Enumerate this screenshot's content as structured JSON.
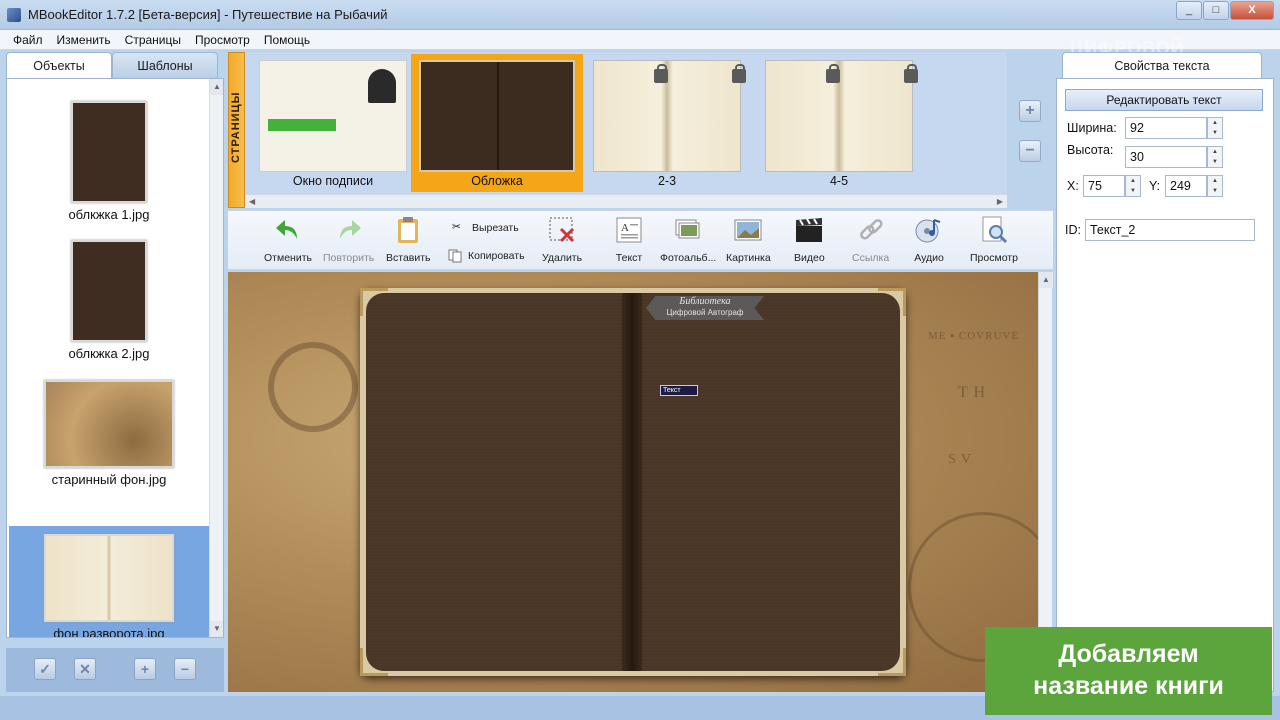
{
  "window": {
    "title": "MBookEditor 1.7.2 [Бета-версия] - Путешествие на Рыбачий",
    "buttons": [
      "_",
      "□",
      "X"
    ]
  },
  "menu": [
    "Файл",
    "Изменить",
    "Страницы",
    "Просмотр",
    "Помощь"
  ],
  "left_panel": {
    "tabs": [
      "Объекты",
      "Шаблоны"
    ],
    "items": [
      {
        "label": "облкжка 1.jpg"
      },
      {
        "label": "облкжка 2.jpg"
      },
      {
        "label": "старинный фон.jpg"
      },
      {
        "label": "фон разворота.jpg",
        "selected": true
      }
    ]
  },
  "pages": {
    "tab_label": "СТРАНИЦЫ",
    "items": [
      {
        "label": "Окно подписи",
        "locked": false,
        "active": false
      },
      {
        "label": "Обложка",
        "locked": false,
        "active": true
      },
      {
        "label": "2-3",
        "locked": true,
        "active": false
      },
      {
        "label": "4-5",
        "locked": true,
        "active": false
      }
    ]
  },
  "toolbar": {
    "undo": "Отменить",
    "redo": "Повторить",
    "paste": "Вставить",
    "cut": "Вырезать",
    "copy": "Копировать",
    "delete": "Удалить",
    "text": "Текст",
    "photoalbum": "Фотоальб...",
    "image": "Картинка",
    "video": "Видео",
    "link": "Ссылка",
    "audio": "Аудио",
    "preview": "Просмотр"
  },
  "canvas": {
    "banner_line1": "Библиотека",
    "banner_line2": "Цифровой Автограф",
    "textbox": "Текст"
  },
  "properties": {
    "tab": "Свойства текста",
    "edit_button": "Редактировать текст",
    "width_label": "Ширина:",
    "width": "92",
    "height_label": "Высота:",
    "height": "30",
    "x_label": "X:",
    "x": "75",
    "y_label": "Y:",
    "y": "249",
    "id_label": "ID:",
    "id": "Текст_2"
  },
  "watermark": "ЦИФРОВОЙ",
  "caption": {
    "line1": "Добавляем",
    "line2": "название книги"
  },
  "colors": {
    "accent_orange": "#f5a518",
    "caption_green": "#5ba53c",
    "selected_blue": "#77a6e0"
  }
}
